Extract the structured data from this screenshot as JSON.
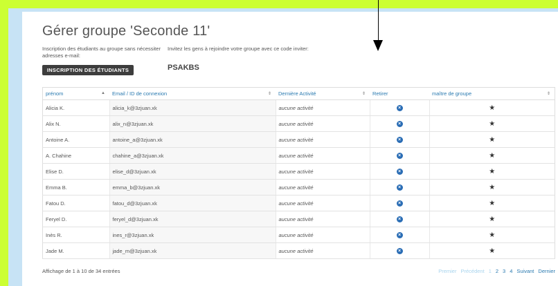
{
  "page": {
    "title": "Gérer groupe 'Seconde 11'",
    "enroll_desc": "Inscription des étudiants au groupe sans nécessiter adresses e-mail:",
    "invite_desc": "Invitez les gens à rejoindre votre groupe avec ce code inviter:",
    "enroll_button": "INSCRIPTION DES ÉTUDIANTS",
    "invite_code": "PSAKBS"
  },
  "table": {
    "headers": [
      "prénom",
      "Email / ID de connexion",
      "Dernière Activité",
      "Retirer",
      "maître de groupe"
    ],
    "rows": [
      {
        "name": "Alicia K.",
        "email": "alicia_k@3zjuan.xk",
        "activity": "aucune activité"
      },
      {
        "name": "Alix N.",
        "email": "alix_n@3zjuan.xk",
        "activity": "aucune activité"
      },
      {
        "name": "Antoine A.",
        "email": "antoine_a@3zjuan.xk",
        "activity": "aucune activité"
      },
      {
        "name": "A. Chahine",
        "email": "chahine_a@3zjuan.xk",
        "activity": "aucune activité"
      },
      {
        "name": "Elise D.",
        "email": "elise_d@3zjuan.xk",
        "activity": "aucune activité"
      },
      {
        "name": "Emma B.",
        "email": "emma_b@3zjuan.xk",
        "activity": "aucune activité"
      },
      {
        "name": "Fatou D.",
        "email": "fatou_d@3zjuan.xk",
        "activity": "aucune activité"
      },
      {
        "name": "Feryel D.",
        "email": "feryel_d@3zjuan.xk",
        "activity": "aucune activité"
      },
      {
        "name": "Inès R.",
        "email": "ines_r@3zjuan.xk",
        "activity": "aucune activité"
      },
      {
        "name": "Jade M.",
        "email": "jade_m@3zjuan.xk",
        "activity": "aucune activité"
      }
    ]
  },
  "footer": {
    "info": "Affichage de 1 à 10 de 34 entrées",
    "pager": [
      "Premier",
      "Précédent",
      "1",
      "2",
      "3",
      "4",
      "Suivant",
      "Dernier"
    ]
  },
  "icons": {
    "remove": "remove-circle-icon",
    "leader": "star-icon"
  },
  "colors": {
    "outer": "#ccff33",
    "frame": "#c7e3f5",
    "link": "#2a7ab0",
    "remove": "#2a6db5"
  }
}
